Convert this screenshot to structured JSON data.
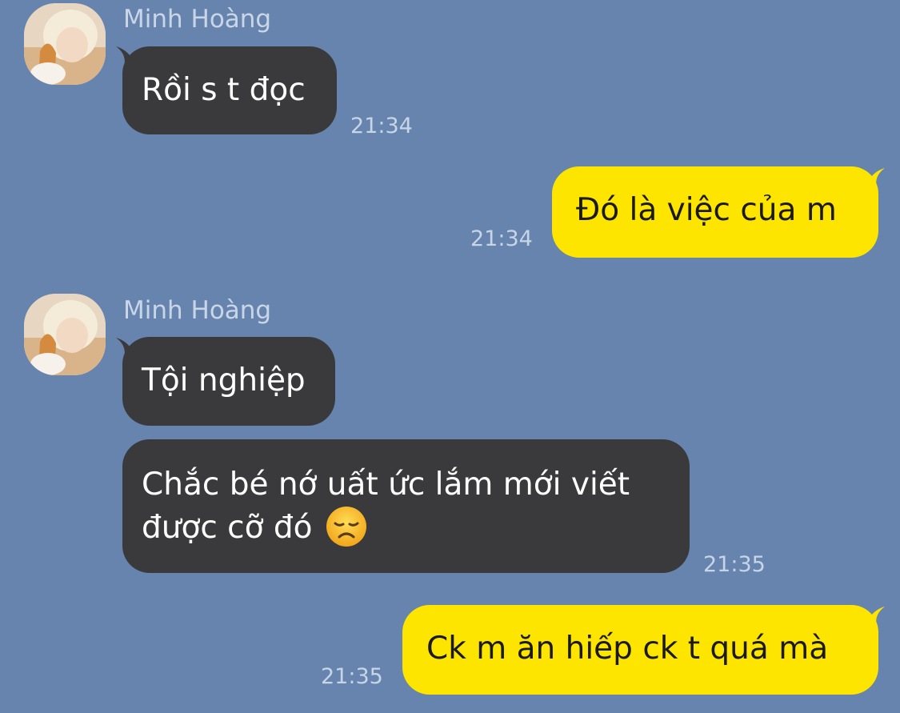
{
  "conversation": {
    "contact_name": "Minh Hoàng",
    "messages": [
      {
        "sender": "Minh Hoàng",
        "direction": "incoming",
        "lines": [
          "Rồi s t đọc"
        ],
        "time": "21:34"
      },
      {
        "direction": "outgoing",
        "lines": [
          "Đó là việc của m"
        ],
        "time": "21:34"
      },
      {
        "sender": "Minh Hoàng",
        "direction": "incoming",
        "lines": [
          "Tội nghiệp"
        ]
      },
      {
        "direction": "incoming",
        "lines": [
          "Chắc bé nớ uất ức lắm mới viết",
          "được cỡ đó"
        ],
        "emoji": "disappointed-face",
        "time": "21:35"
      },
      {
        "direction": "outgoing",
        "lines": [
          "Ck m ăn hiếp ck t quá mà"
        ],
        "time": "21:35"
      }
    ]
  },
  "colors": {
    "background": "#6684ad",
    "incoming_bubble": "#3a3a3c",
    "outgoing_bubble": "#fee500",
    "timestamp": "#c8d5e7",
    "sender_name": "#c9d6e8"
  }
}
